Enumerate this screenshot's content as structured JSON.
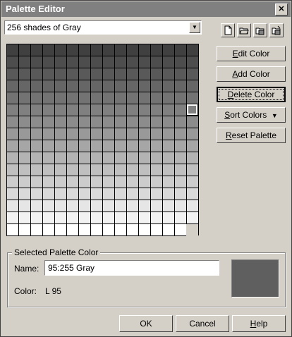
{
  "window": {
    "title": "Palette Editor",
    "close_symbol": "✕"
  },
  "palette_select": {
    "value": "256 shades of Gray"
  },
  "toolbar_icons": [
    "new-palette-icon",
    "open-palette-icon",
    "save-palette-icon",
    "save-as-palette-icon"
  ],
  "palette": {
    "rows": 16,
    "columns": 16,
    "filled_cells_last_row": 15,
    "selected_index": 95,
    "gray_start": 64,
    "gray_end": 255
  },
  "side_buttons": {
    "edit": {
      "pre": "",
      "key": "E",
      "post": "dit Color"
    },
    "add": {
      "pre": "",
      "key": "A",
      "post": "dd Color"
    },
    "delete": {
      "pre": "",
      "key": "D",
      "post": "elete Color"
    },
    "sort": {
      "pre": "",
      "key": "S",
      "post": "ort Colors",
      "arrow": "▼"
    },
    "reset": {
      "pre": "",
      "key": "R",
      "post": "eset Palette"
    }
  },
  "selected": {
    "legend": "Selected Palette Color",
    "name_label": "Name:",
    "name_value": "95:255  Gray",
    "color_label": "Color:",
    "color_value": "L  95",
    "swatch_color": "#5f5f5f"
  },
  "bottom_buttons": {
    "ok": "OK",
    "cancel": "Cancel",
    "help": {
      "pre": "",
      "key": "H",
      "post": "elp"
    }
  }
}
